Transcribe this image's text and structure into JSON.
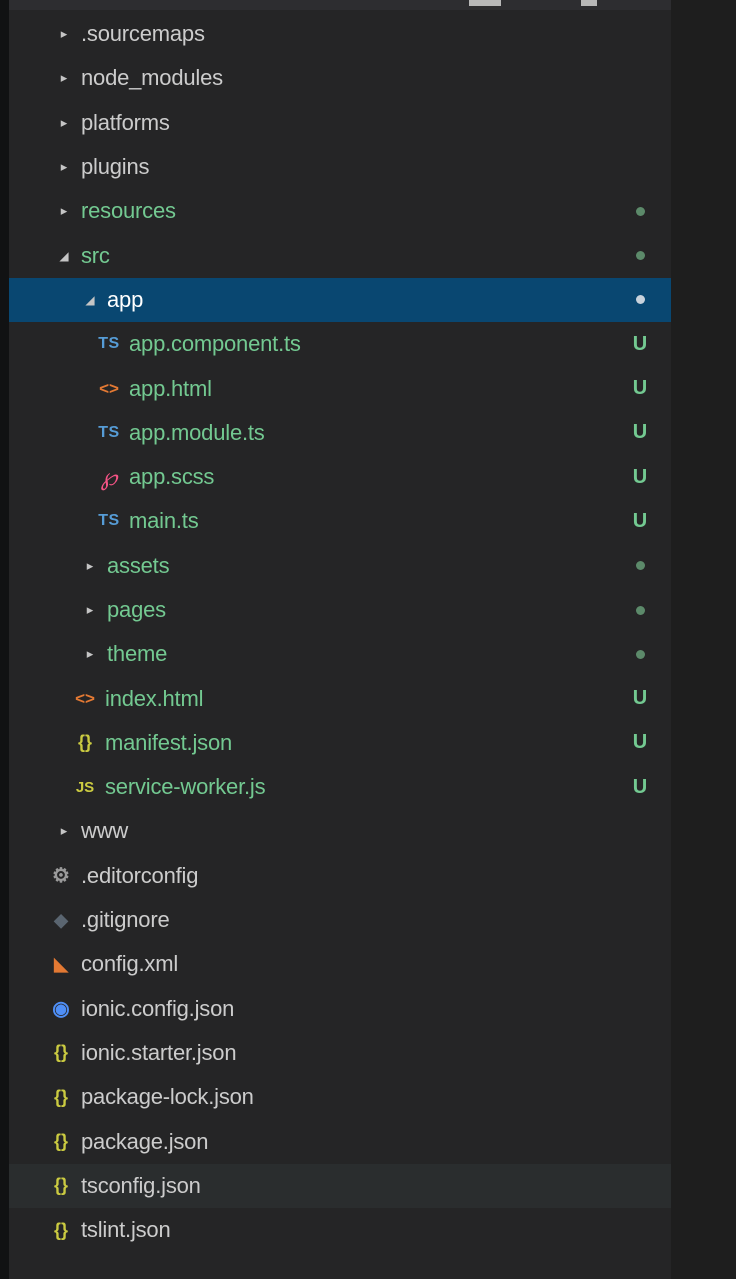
{
  "explorer": {
    "tree": [
      {
        "name": ".sourcemaps",
        "kind": "folder",
        "state": "collapsed",
        "status": ""
      },
      {
        "name": "node_modules",
        "kind": "folder",
        "state": "collapsed",
        "status": ""
      },
      {
        "name": "platforms",
        "kind": "folder",
        "state": "collapsed",
        "status": ""
      },
      {
        "name": "plugins",
        "kind": "folder",
        "state": "collapsed",
        "status": ""
      },
      {
        "name": "resources",
        "kind": "folder",
        "state": "collapsed",
        "status": "dot"
      },
      {
        "name": "src",
        "kind": "folder",
        "state": "expanded",
        "status": "dot"
      },
      {
        "name": "app",
        "kind": "folder",
        "state": "expanded",
        "status": "dot",
        "selected": true
      },
      {
        "name": "app.component.ts",
        "kind": "file",
        "icon": "typescript-icon",
        "status": "U"
      },
      {
        "name": "app.html",
        "kind": "file",
        "icon": "html-icon",
        "status": "U"
      },
      {
        "name": "app.module.ts",
        "kind": "file",
        "icon": "typescript-icon",
        "status": "U"
      },
      {
        "name": "app.scss",
        "kind": "file",
        "icon": "sass-icon",
        "status": "U"
      },
      {
        "name": "main.ts",
        "kind": "file",
        "icon": "typescript-icon",
        "status": "U"
      },
      {
        "name": "assets",
        "kind": "folder",
        "state": "collapsed",
        "status": "dot"
      },
      {
        "name": "pages",
        "kind": "folder",
        "state": "collapsed",
        "status": "dot"
      },
      {
        "name": "theme",
        "kind": "folder",
        "state": "collapsed",
        "status": "dot"
      },
      {
        "name": "index.html",
        "kind": "file",
        "icon": "html-icon",
        "status": "U"
      },
      {
        "name": "manifest.json",
        "kind": "file",
        "icon": "json-icon",
        "status": "U"
      },
      {
        "name": "service-worker.js",
        "kind": "file",
        "icon": "javascript-icon",
        "status": "U"
      },
      {
        "name": "www",
        "kind": "folder",
        "state": "collapsed",
        "status": ""
      },
      {
        "name": ".editorconfig",
        "kind": "file",
        "icon": "gear-icon",
        "status": ""
      },
      {
        "name": ".gitignore",
        "kind": "file",
        "icon": "git-icon",
        "status": ""
      },
      {
        "name": "config.xml",
        "kind": "file",
        "icon": "rss-icon",
        "status": ""
      },
      {
        "name": "ionic.config.json",
        "kind": "file",
        "icon": "ionic-icon",
        "status": ""
      },
      {
        "name": "ionic.starter.json",
        "kind": "file",
        "icon": "json-icon",
        "status": ""
      },
      {
        "name": "package-lock.json",
        "kind": "file",
        "icon": "json-icon",
        "status": ""
      },
      {
        "name": "package.json",
        "kind": "file",
        "icon": "json-icon",
        "status": ""
      },
      {
        "name": "tsconfig.json",
        "kind": "file",
        "icon": "json-icon",
        "status": "",
        "hover": true
      },
      {
        "name": "tslint.json",
        "kind": "file",
        "icon": "json-icon",
        "status": ""
      }
    ],
    "icon_glyphs": {
      "typescript-icon": "TS",
      "html-icon": "<>",
      "sass-icon": "℘",
      "json-icon": "{}",
      "javascript-icon": "JS",
      "gear-icon": "⚙",
      "git-icon": "◆",
      "rss-icon": "◣",
      "ionic-icon": "◉"
    },
    "colors": {
      "modified_green": "#73c991",
      "selection": "#094771",
      "typescript_blue": "#569cd6",
      "html_orange": "#e37933",
      "json_yellow": "#cbcb41"
    }
  }
}
